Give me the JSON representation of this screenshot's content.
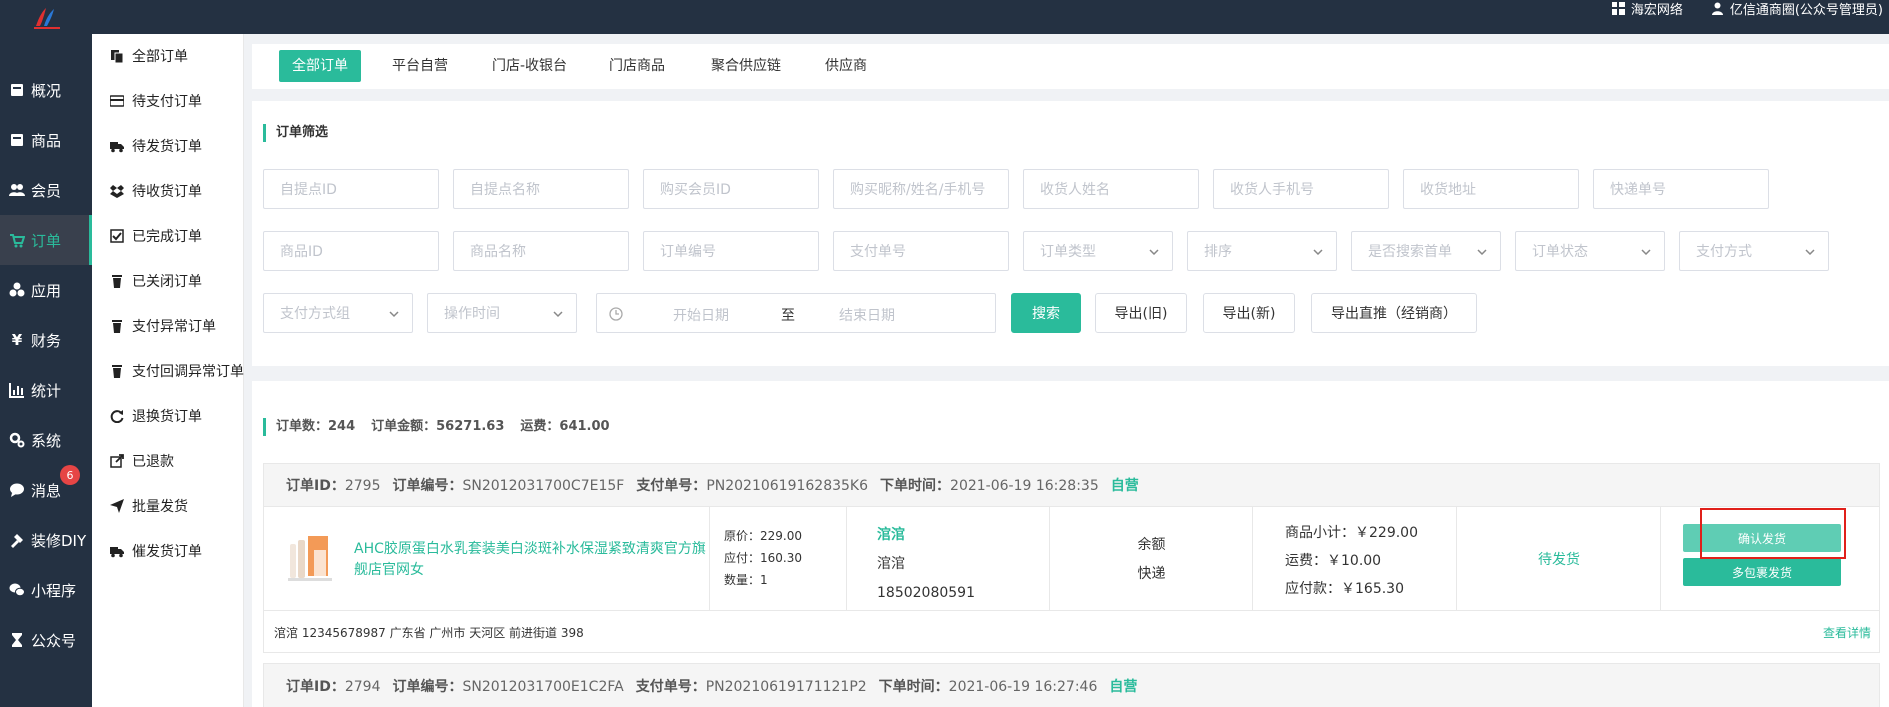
{
  "header": {
    "org_name": "海宏网络",
    "user_name": "亿信通商圈(公众号管理员)"
  },
  "nav": {
    "items": [
      {
        "label": "概况",
        "icon": "dashboard-icon"
      },
      {
        "label": "商品",
        "icon": "goods-icon"
      },
      {
        "label": "会员",
        "icon": "users-icon"
      },
      {
        "label": "订单",
        "icon": "cart-icon"
      },
      {
        "label": "应用",
        "icon": "apps-icon"
      },
      {
        "label": "财务",
        "icon": "yen-icon"
      },
      {
        "label": "统计",
        "icon": "stats-icon"
      },
      {
        "label": "系统",
        "icon": "gear-icon"
      },
      {
        "label": "消息",
        "icon": "message-icon"
      },
      {
        "label": "装修DIY",
        "icon": "paint-icon"
      },
      {
        "label": "小程序",
        "icon": "wechat-icon"
      },
      {
        "label": "公众号",
        "icon": "hourglass-icon"
      }
    ],
    "message_badge": "6"
  },
  "subnav": {
    "items": [
      "全部订单",
      "待支付订单",
      "待发货订单",
      "待收货订单",
      "已完成订单",
      "已关闭订单",
      "支付异常订单",
      "支付回调异常订单",
      "退换货订单",
      "已退款",
      "批量发货",
      "催发货订单"
    ]
  },
  "tabs": [
    "全部订单",
    "平台自营",
    "门店-收银台",
    "门店商品",
    "聚合供应链",
    "供应商"
  ],
  "filter": {
    "title": "订单筛选",
    "row1": [
      "自提点ID",
      "自提点名称",
      "购买会员ID",
      "购买昵称/姓名/手机号",
      "收货人姓名",
      "收货人手机号",
      "收货地址",
      "快递单号"
    ],
    "row2_inputs": [
      "商品ID",
      "商品名称",
      "订单编号",
      "支付单号"
    ],
    "row2_selects": [
      "订单类型",
      "排序",
      "是否搜索首单",
      "订单状态",
      "支付方式"
    ],
    "row3_selects": [
      "支付方式组",
      "操作时间"
    ],
    "date_start": "开始日期",
    "date_sep": "至",
    "date_end": "结束日期",
    "search_btn": "搜索",
    "export_old": "导出(旧)",
    "export_new": "导出(新)",
    "export_direct": "导出直推（经销商）"
  },
  "summary": {
    "count": "订单数：244",
    "amount": "订单金额：56271.63",
    "freight": "运费：641.00"
  },
  "orders": [
    {
      "id_label": "订单ID：",
      "id": "2795",
      "sn_label": "订单编号：",
      "sn": "SN2012031700C7E15F",
      "pay_label": "支付单号：",
      "pay": "PN20210619162835K6",
      "time_label": "下单时间：",
      "time": "2021-06-19 16:28:35",
      "tag": "自营",
      "product": "AHC胶原蛋白水乳套装美白淡斑补水保湿紧致清爽官方旗舰店官网女",
      "orig_price": "原价：229.00",
      "should_pay": "应付：160.30",
      "qty": "数量：1",
      "buyer_nick": "涫涫",
      "buyer_name": "涫涫",
      "buyer_phone": "18502080591",
      "pay_method": "余额",
      "ship_method": "快递",
      "subtotal": "商品小计：￥229.00",
      "freight": "运费：￥10.00",
      "payable": "应付款：￥165.30",
      "status": "待发货",
      "confirm_btn": "确认发货",
      "multi_btn": "多包裹发货",
      "address": "涫涫   12345678987  广东省 广州市 天河区 前进街道 398",
      "detail_link": "查看详情"
    },
    {
      "id_label": "订单ID：",
      "id": "2794",
      "sn_label": "订单编号：",
      "sn": "SN2012031700E1C2FA",
      "pay_label": "支付单号：",
      "pay": "PN20210619171121P2",
      "time_label": "下单时间：",
      "time": "2021-06-19 16:27:46",
      "tag": "自营"
    }
  ],
  "colors": {
    "accent": "#2abb9b",
    "sidebar": "#243142",
    "highlight": "#e0201a"
  }
}
